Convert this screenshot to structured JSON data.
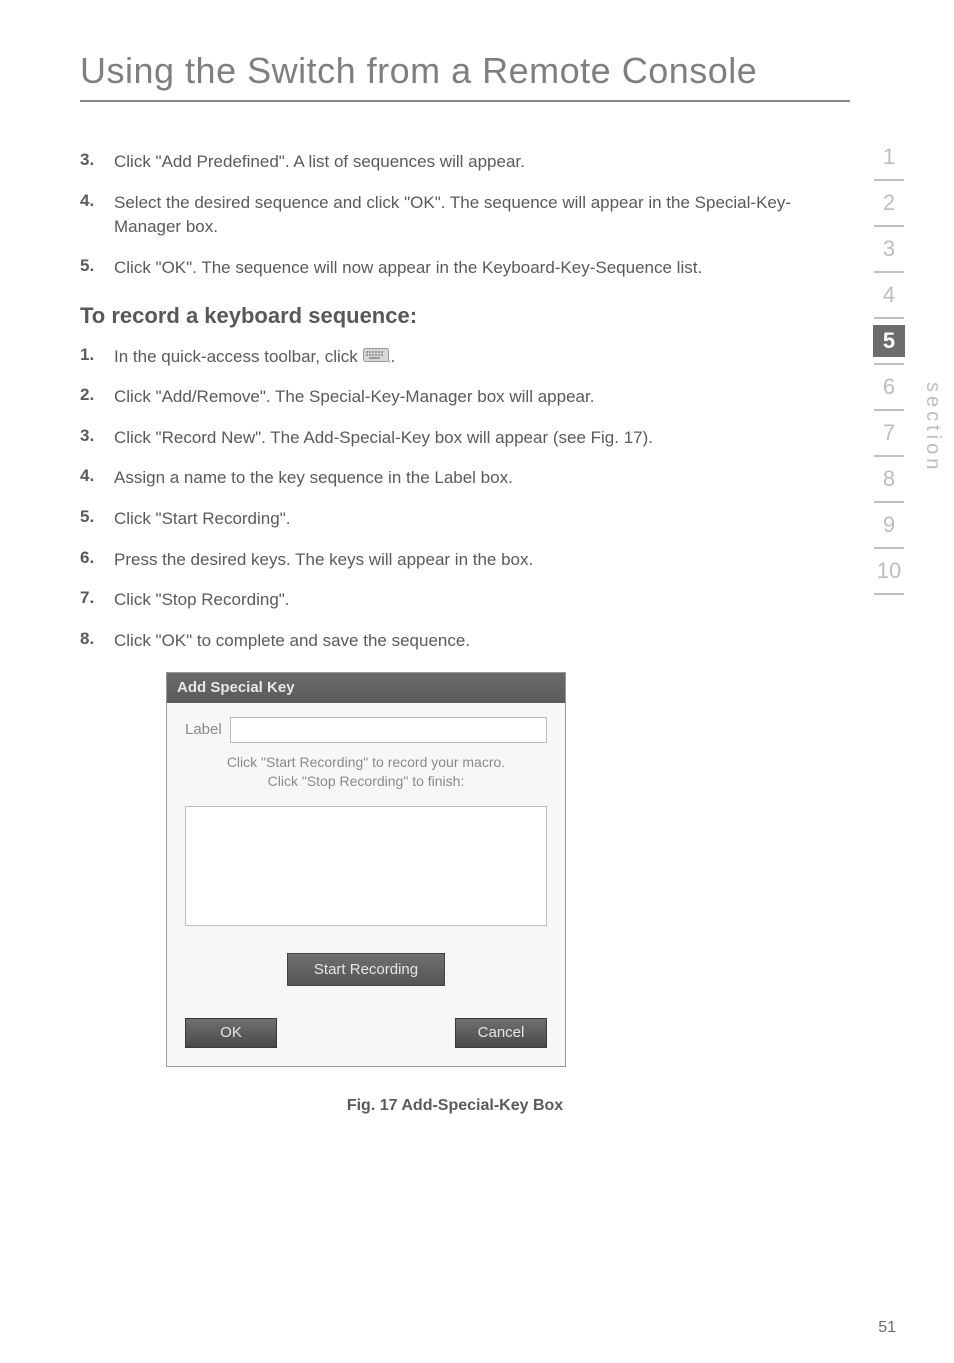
{
  "header": {
    "title": "Using the Switch from a Remote Console"
  },
  "steps_top": [
    {
      "num": "3.",
      "text": "Click \"Add Predefined\". A list of sequences will appear."
    },
    {
      "num": "4.",
      "text": "Select the desired sequence and click \"OK\". The sequence will appear in the Special-Key-Manager box."
    },
    {
      "num": "5.",
      "text": "Click \"OK\". The sequence will now appear in the Keyboard-Key-Sequence list."
    }
  ],
  "subheading": "To record a keyboard sequence:",
  "steps_record": [
    {
      "num": "1.",
      "before": "In the quick-access toolbar, click ",
      "after": "."
    },
    {
      "num": "2.",
      "text": "Click \"Add/Remove\". The Special-Key-Manager box will appear."
    },
    {
      "num": "3.",
      "text": "Click \"Record New\". The Add-Special-Key box will appear (see Fig. 17)."
    },
    {
      "num": "4.",
      "text": "Assign a name to the key sequence in the Label box."
    },
    {
      "num": "5.",
      "text": "Click \"Start Recording\"."
    },
    {
      "num": "6.",
      "text": "Press the desired keys. The keys will appear in the box."
    },
    {
      "num": "7.",
      "text": "Click \"Stop Recording\"."
    },
    {
      "num": "8.",
      "text": "Click \"OK\" to complete and save the sequence."
    }
  ],
  "dialog": {
    "title": "Add Special Key",
    "label": "Label",
    "input_value": "",
    "hint_line1": "Click \"Start Recording\" to record your macro.",
    "hint_line2": "Click \"Stop Recording\" to finish:",
    "textarea_value": "",
    "start_btn": "Start Recording",
    "ok_btn": "OK",
    "cancel_btn": "Cancel"
  },
  "caption": "Fig. 17 Add-Special-Key Box",
  "side_index": {
    "items": [
      "1",
      "2",
      "3",
      "4",
      "5",
      "6",
      "7",
      "8",
      "9",
      "10"
    ],
    "active": "5",
    "label": "section"
  },
  "page_number": "51"
}
